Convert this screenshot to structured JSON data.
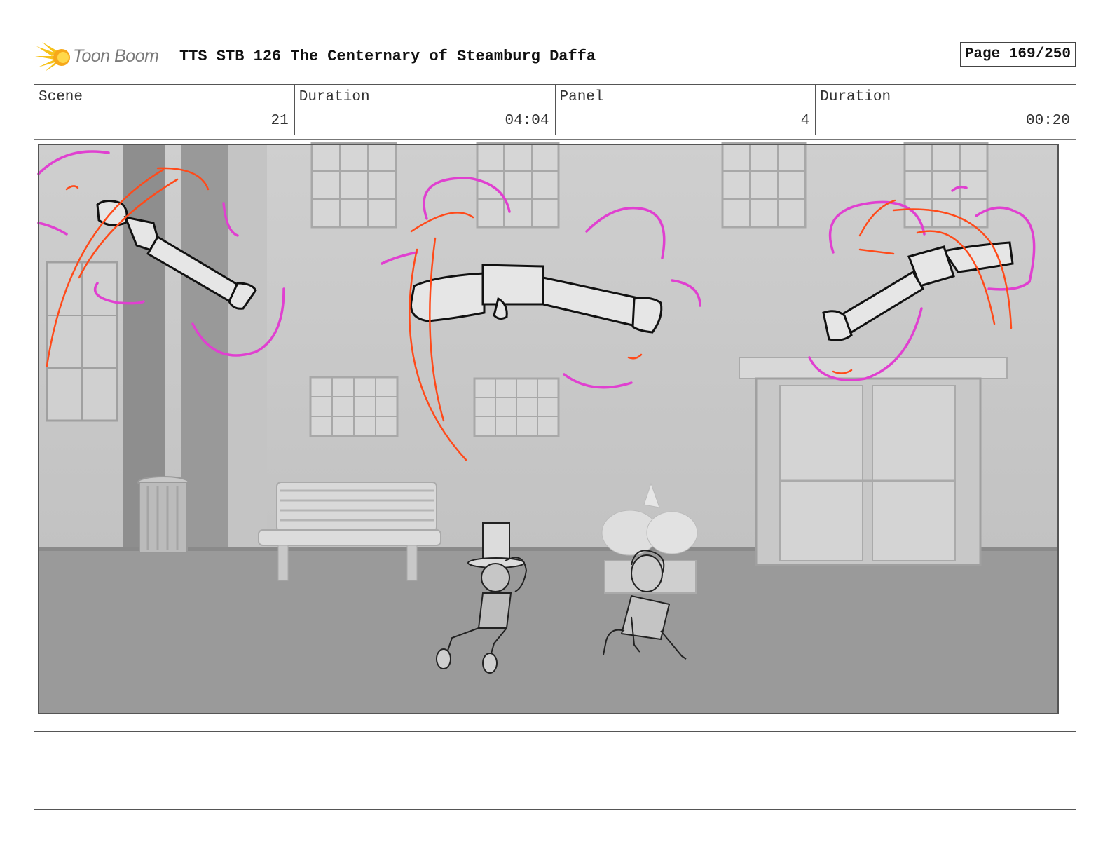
{
  "header": {
    "logo_text": "Toon Boom",
    "title": "TTS STB 126 The Centernary of Steamburg Daffa",
    "page": "Page 169/250"
  },
  "info": {
    "scene_label": "Scene",
    "scene_value": "21",
    "scene_duration_label": "Duration",
    "scene_duration_value": "04:04",
    "panel_label": "Panel",
    "panel_value": "4",
    "panel_duration_label": "Duration",
    "panel_duration_value": "00:20"
  },
  "colors": {
    "motion_magenta": "#e040d0",
    "motion_red": "#ff4a1a",
    "logo_yellow": "#f7c21a"
  },
  "notes": {
    "text": ""
  }
}
